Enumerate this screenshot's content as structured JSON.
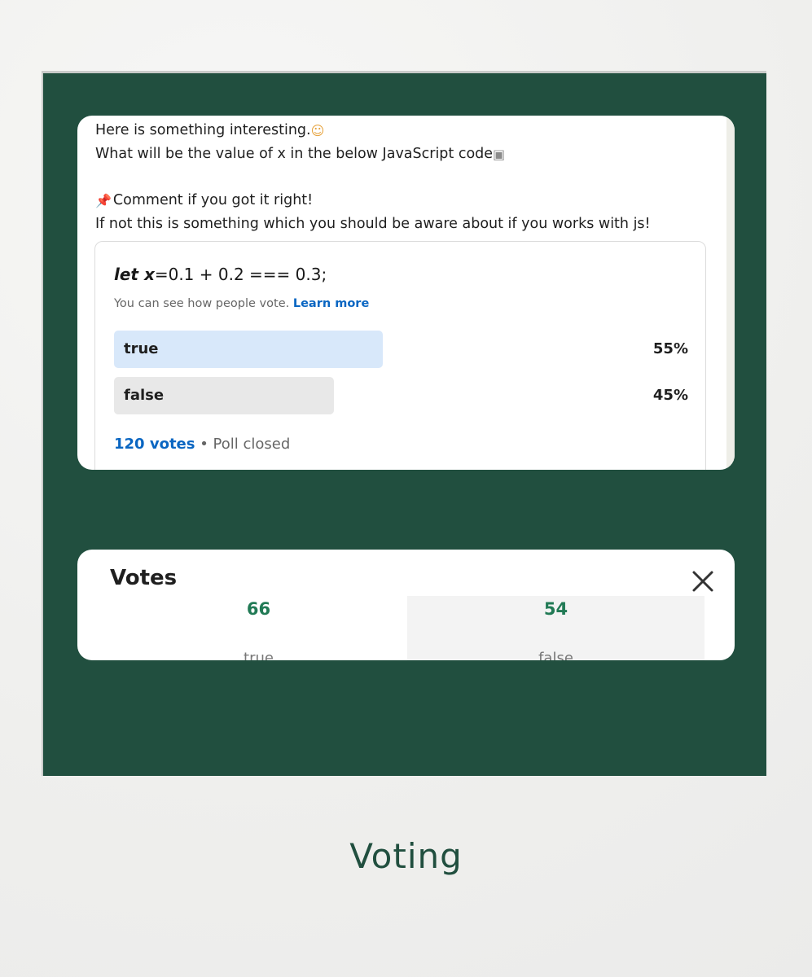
{
  "post": {
    "line1": "Here is something interesting.",
    "line1_emoji": "nerd-face-emoji",
    "line2": "What will be the value of x in the below JavaScript code",
    "line2_emoji": "technologist-emoji",
    "line3": "Comment if you got it right!",
    "line3_emoji": "pushpin-emoji",
    "line4": "If not this is something which you should be aware about if you works with js!"
  },
  "poll": {
    "question_keyword": "let x",
    "question_rest": "=0.1 + 0.2 === 0.3;",
    "note": "You can see how people vote.",
    "learn_more": "Learn more",
    "options": [
      {
        "label": "true",
        "percent_text": "55%",
        "fraction": 0.55,
        "selected": true
      },
      {
        "label": "false",
        "percent_text": "45%",
        "fraction": 0.45,
        "selected": false
      }
    ],
    "votes_link": "120 votes",
    "separator": " • ",
    "status": "Poll closed"
  },
  "votes_modal": {
    "title": "Votes",
    "close_icon": "close-icon",
    "columns": [
      {
        "count": "66",
        "label": "true"
      },
      {
        "count": "54",
        "label": "false"
      }
    ]
  },
  "caption": "Voting",
  "colors": {
    "frame_bg": "#214f3f",
    "link_blue": "#0a66c2",
    "count_green": "#217a55",
    "selected_bar": "#d8e8fa",
    "unselected_bar": "#e8e8e8"
  }
}
